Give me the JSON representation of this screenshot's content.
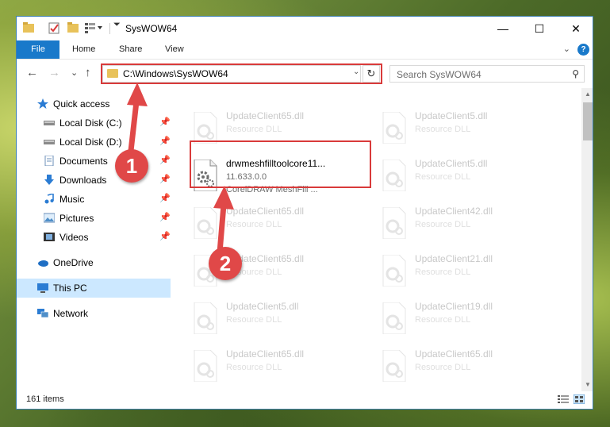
{
  "window": {
    "title": "SysWOW64",
    "minimize_glyph": "—",
    "maximize_glyph": "☐",
    "close_glyph": "✕"
  },
  "ribbon": {
    "tabs": [
      "File",
      "Home",
      "Share",
      "View"
    ],
    "help_glyph": "?",
    "collapse_glyph": "⌄"
  },
  "navigation": {
    "back_glyph": "←",
    "forward_glyph": "→",
    "recent_glyph": "⌄",
    "up_glyph": "↑",
    "address": "C:\\Windows\\SysWOW64",
    "address_dropdown_glyph": "⌄",
    "refresh_glyph": "↻",
    "search_placeholder": "Search SysWOW64",
    "search_glyph": "⚲"
  },
  "sidebar": {
    "pin_glyph": "📌",
    "items": [
      {
        "label": "Quick access",
        "icon": "star-icon"
      },
      {
        "label": "Local Disk (C:)",
        "icon": "drive-icon",
        "pinned": true
      },
      {
        "label": "Local Disk (D:)",
        "icon": "drive-icon",
        "pinned": true
      },
      {
        "label": "Documents",
        "icon": "documents-icon",
        "pinned": true
      },
      {
        "label": "Downloads",
        "icon": "downloads-icon",
        "pinned": true
      },
      {
        "label": "Music",
        "icon": "music-icon",
        "pinned": true
      },
      {
        "label": "Pictures",
        "icon": "pictures-icon",
        "pinned": true
      },
      {
        "label": "Videos",
        "icon": "videos-icon",
        "pinned": true
      },
      {
        "label": "OneDrive",
        "icon": "cloud-icon"
      },
      {
        "label": "This PC",
        "icon": "computer-icon",
        "selected": true
      },
      {
        "label": "Network",
        "icon": "network-icon"
      }
    ]
  },
  "files": {
    "highlighted": {
      "name": "drwmeshfilltoolcore11...",
      "version": "11.633.0.0",
      "description": "CorelDRAW MeshFill ..."
    },
    "left_column": [
      {
        "name": "UpdateClient65.dll",
        "type": "Resource DLL"
      },
      {
        "name": "UpdateClient65.dll",
        "type": "Resource DLL"
      },
      {
        "name": "UpdateClient65.dll",
        "type": "Resource DLL"
      },
      {
        "name": "UpdateClient5.dll",
        "type": "Resource DLL"
      },
      {
        "name": "UpdateClient65.dll",
        "type": "Resource DLL"
      }
    ],
    "right_column": [
      {
        "name": "UpdateClient5.dll",
        "type": "Resource DLL"
      },
      {
        "name": "UpdateClient5.dll",
        "type": "Resource DLL"
      },
      {
        "name": "UpdateClient42.dll",
        "type": "Resource DLL"
      },
      {
        "name": "UpdateClient21.dll",
        "type": "Resource DLL"
      },
      {
        "name": "UpdateClient19.dll",
        "type": "Resource DLL"
      },
      {
        "name": "UpdateClient65.dll",
        "type": "Resource DLL"
      }
    ]
  },
  "status": {
    "item_count": "161 items"
  },
  "annotations": {
    "step1": "1",
    "step2": "2",
    "color": "#e04848"
  },
  "colors": {
    "accent": "#1979ca",
    "highlight_border": "#d93a3a",
    "selected_bg": "#cce8ff"
  }
}
